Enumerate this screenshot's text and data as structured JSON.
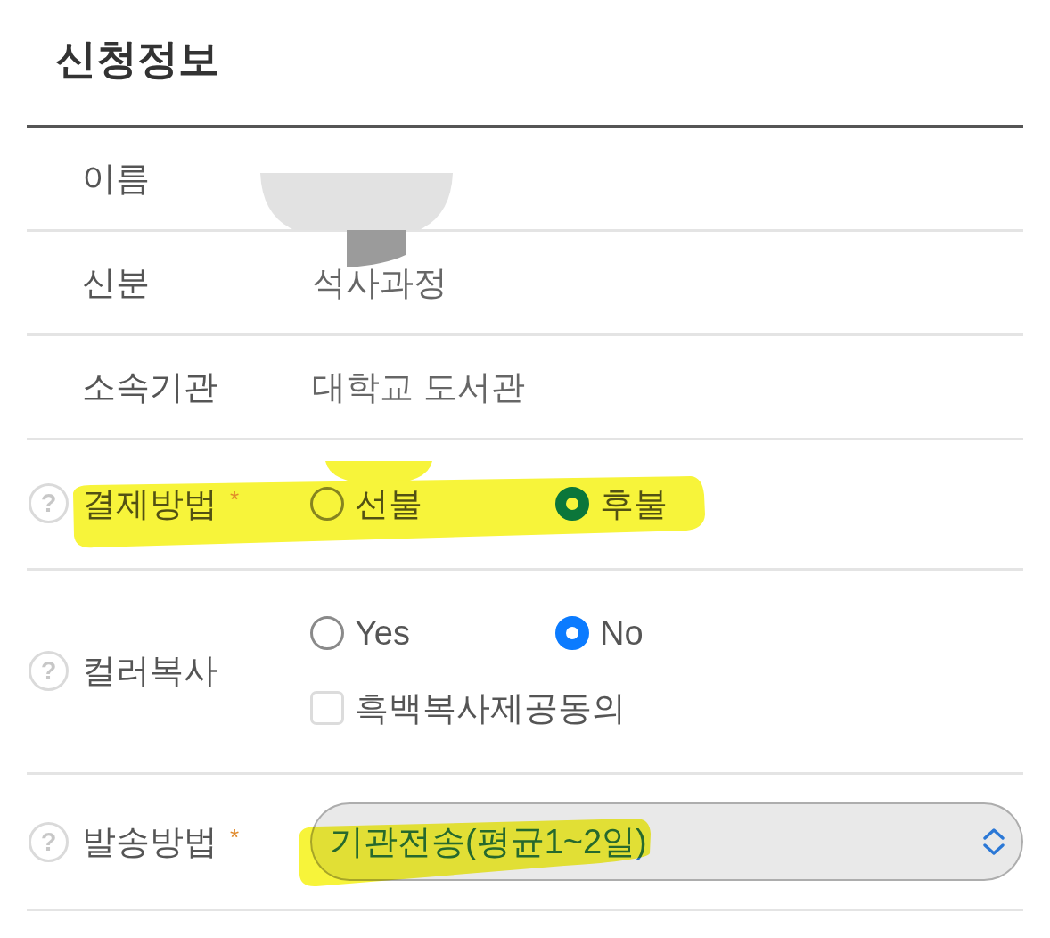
{
  "title": "신청정보",
  "rows": [
    {
      "kind": "text",
      "label": "이름"
    },
    {
      "kind": "text",
      "label": "신분",
      "value": "석사과정"
    },
    {
      "kind": "text",
      "label": "소속기관",
      "value": "대학교 도서관"
    },
    {
      "kind": "radio",
      "help": "?",
      "label": "결제방법",
      "mark": "*",
      "highlighted": true,
      "options": [
        {
          "label": "선불",
          "selected": false
        },
        {
          "label": "후불",
          "selected": true
        }
      ]
    },
    {
      "kind": "radio",
      "help": "?",
      "label": "컬러복사",
      "options": [
        {
          "label": "Yes",
          "selected": false
        },
        {
          "label": "No",
          "selected": true
        }
      ],
      "checkbox": {
        "label": "흑백복사제공동의",
        "checked": false
      }
    },
    {
      "kind": "select",
      "help": "?",
      "label": "발송방법",
      "mark": "*",
      "highlighted": true,
      "value": "기관전송(평균1~2일)"
    }
  ]
}
